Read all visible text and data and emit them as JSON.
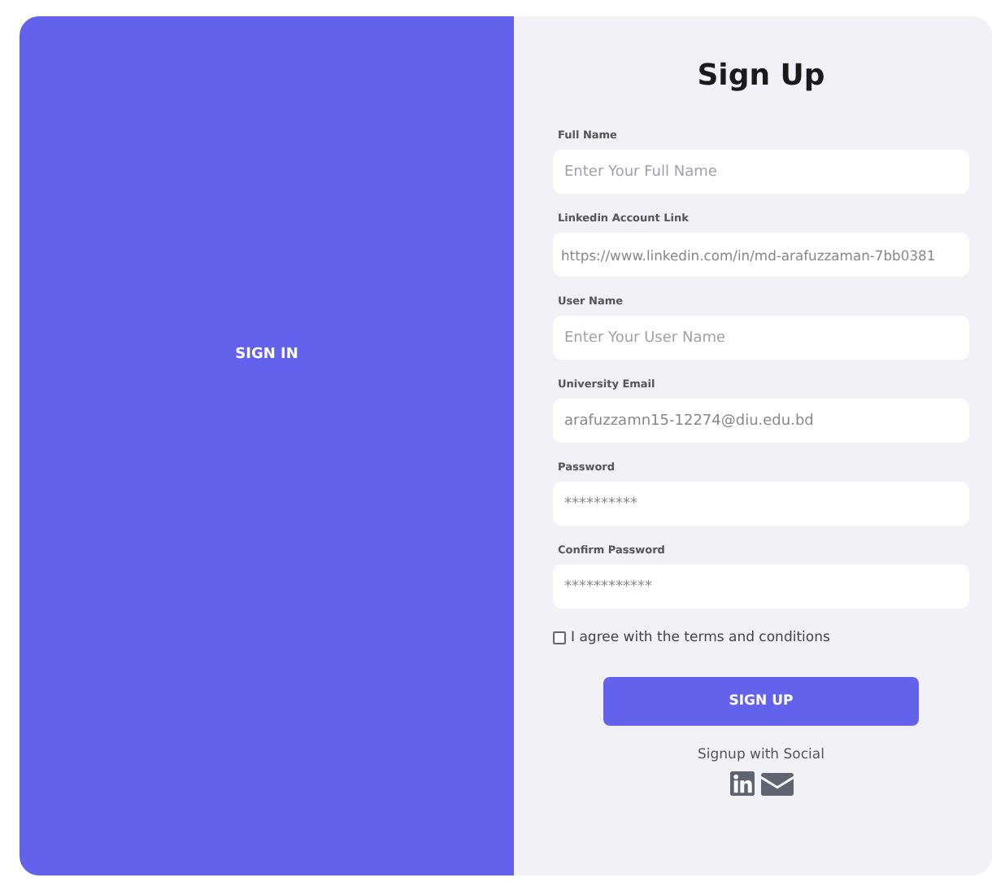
{
  "left_panel": {
    "link": "SIGN IN"
  },
  "form": {
    "title": "Sign Up",
    "fields": [
      {
        "label": "Full Name",
        "placeholder": "Enter Your Full Name"
      },
      {
        "label": "Linkedin Account Link",
        "value": "https://www.linkedin.com/in/md-arafuzzaman-7bb0381"
      },
      {
        "label": "User Name",
        "placeholder": "Enter Your User Name"
      },
      {
        "label": "University Email",
        "value": "arafuzzamn15-12274@diu.edu.bd"
      },
      {
        "label": "Password",
        "value": "**********"
      },
      {
        "label": "Confirm Password",
        "value": "************"
      }
    ],
    "agree": {
      "label": "I agree with the terms and conditions",
      "checked": false
    },
    "submit": "SIGN UP",
    "social_caption": "Signup with Social"
  }
}
